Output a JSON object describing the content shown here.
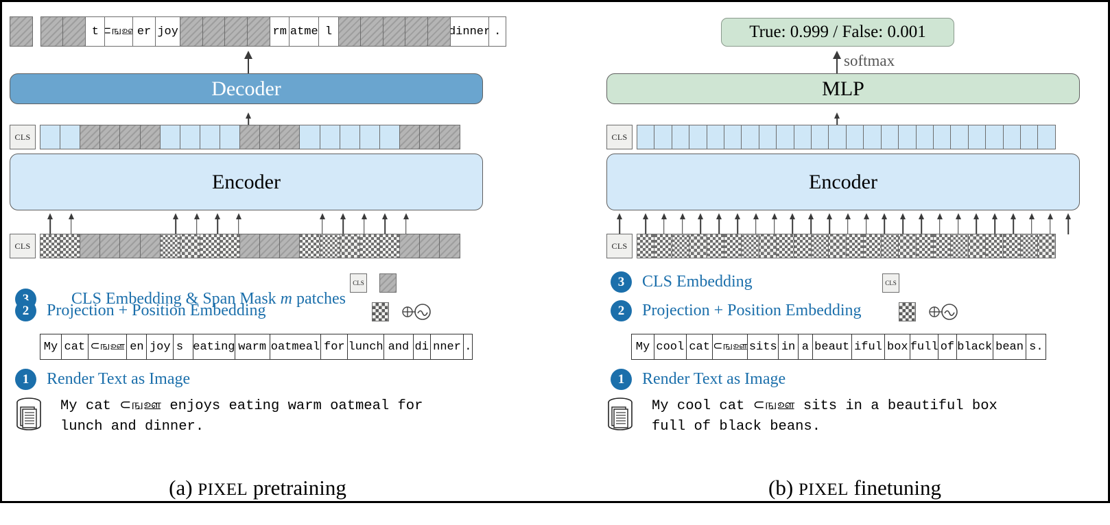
{
  "figure": {
    "panels": [
      {
        "id": "a",
        "caption_prefix": "(a) ",
        "caption_small": "PIXEL",
        "caption_suffix": " pretraining",
        "encoder_label": "Encoder",
        "decoder_label": "Decoder",
        "cls_label": "CLS",
        "source_text_line1": "My cat ⊂ஙஊ enjoys eating warm oatmeal for",
        "source_text_line2": "lunch and dinner.",
        "rendered_patches": [
          "My",
          "cat",
          "⊂ஙஊ",
          "en",
          "joy",
          "s ",
          "eating",
          "warm",
          "oatmeal",
          "for",
          "lunch",
          "and",
          "di",
          "nner",
          "."
        ],
        "reconstruction_patches": [
          {
            "text": "",
            "masked": true
          },
          {
            "text": "",
            "masked": true
          },
          {
            "text": "",
            "masked": true
          },
          {
            "text": "t",
            "masked": false
          },
          {
            "text": "⊂ஙஊ",
            "masked": false
          },
          {
            "text": "er",
            "masked": false
          },
          {
            "text": "joy",
            "masked": false
          },
          {
            "text": "",
            "masked": true
          },
          {
            "text": "",
            "masked": true
          },
          {
            "text": "",
            "masked": true
          },
          {
            "text": "",
            "masked": true
          },
          {
            "text": "rm",
            "masked": false
          },
          {
            "text": "oatmea",
            "masked": false
          },
          {
            "text": "l",
            "masked": false
          },
          {
            "text": "",
            "masked": true
          },
          {
            "text": "",
            "masked": true
          },
          {
            "text": "",
            "masked": true
          },
          {
            "text": "",
            "masked": true
          },
          {
            "text": "",
            "masked": true
          },
          {
            "text": "dinner",
            "masked": false
          },
          {
            "text": ".",
            "masked": false
          }
        ],
        "encoder_output_mask": [
          false,
          false,
          true,
          true,
          true,
          true,
          false,
          false,
          false,
          false,
          true,
          true,
          true,
          false,
          false,
          false,
          false,
          false,
          true,
          true,
          true
        ],
        "encoder_input_mask": [
          false,
          false,
          true,
          true,
          true,
          true,
          false,
          false,
          false,
          false,
          true,
          true,
          true,
          false,
          false,
          false,
          false,
          false,
          true,
          true,
          true
        ],
        "legend": [
          {
            "number": "3",
            "label_before": "CLS Embedding & Span Mask ",
            "label_italic": "m",
            "label_after": " patches",
            "icons": [
              "cls-icon",
              "span-mask-icon"
            ]
          },
          {
            "number": "2",
            "label_before": "Projection + Position Embedding",
            "label_italic": "",
            "label_after": "",
            "icons": [
              "checker-patch-icon",
              "position-embedding-icon"
            ]
          },
          {
            "number": "1",
            "label_before": "Render Text as Image",
            "label_italic": "",
            "label_after": "",
            "icons": []
          }
        ]
      },
      {
        "id": "b",
        "caption_prefix": "(b) ",
        "caption_small": "PIXEL",
        "caption_suffix": " finetuning",
        "encoder_label": "Encoder",
        "mlp_label": "MLP",
        "cls_label": "CLS",
        "softmax_label": "softmax",
        "prediction": "True: 0.999 / False: 0.001",
        "source_text_line1": "My cool cat ⊂ஙஊ sits in a beautiful box",
        "source_text_line2": "full of black beans.",
        "rendered_patches": [
          "My",
          "cool",
          "cat",
          "⊂ஙஊ",
          "sits",
          "in",
          "a",
          "beaut",
          "iful",
          "box",
          "full",
          "of",
          "black",
          "bean",
          "s."
        ],
        "encoder_output_count": 24,
        "encoder_input_count": 24,
        "legend": [
          {
            "number": "3",
            "label_before": "CLS Embedding",
            "label_italic": "",
            "label_after": "",
            "icons": [
              "cls-icon"
            ]
          },
          {
            "number": "2",
            "label_before": "Projection + Position Embedding",
            "label_italic": "",
            "label_after": "",
            "icons": [
              "checker-patch-icon",
              "position-embedding-icon"
            ]
          },
          {
            "number": "1",
            "label_before": "Render Text as Image",
            "label_italic": "",
            "label_after": "",
            "icons": []
          }
        ]
      }
    ],
    "colors": {
      "encoder": "#d4e9f9",
      "decoder": "#6aa5cf",
      "mlp": "#cfe5d3",
      "badge": "#1b6fab",
      "legend_text": "#1b6fab",
      "mask": "#a9a9a9",
      "patch_blue": "#cfe7f7"
    }
  }
}
